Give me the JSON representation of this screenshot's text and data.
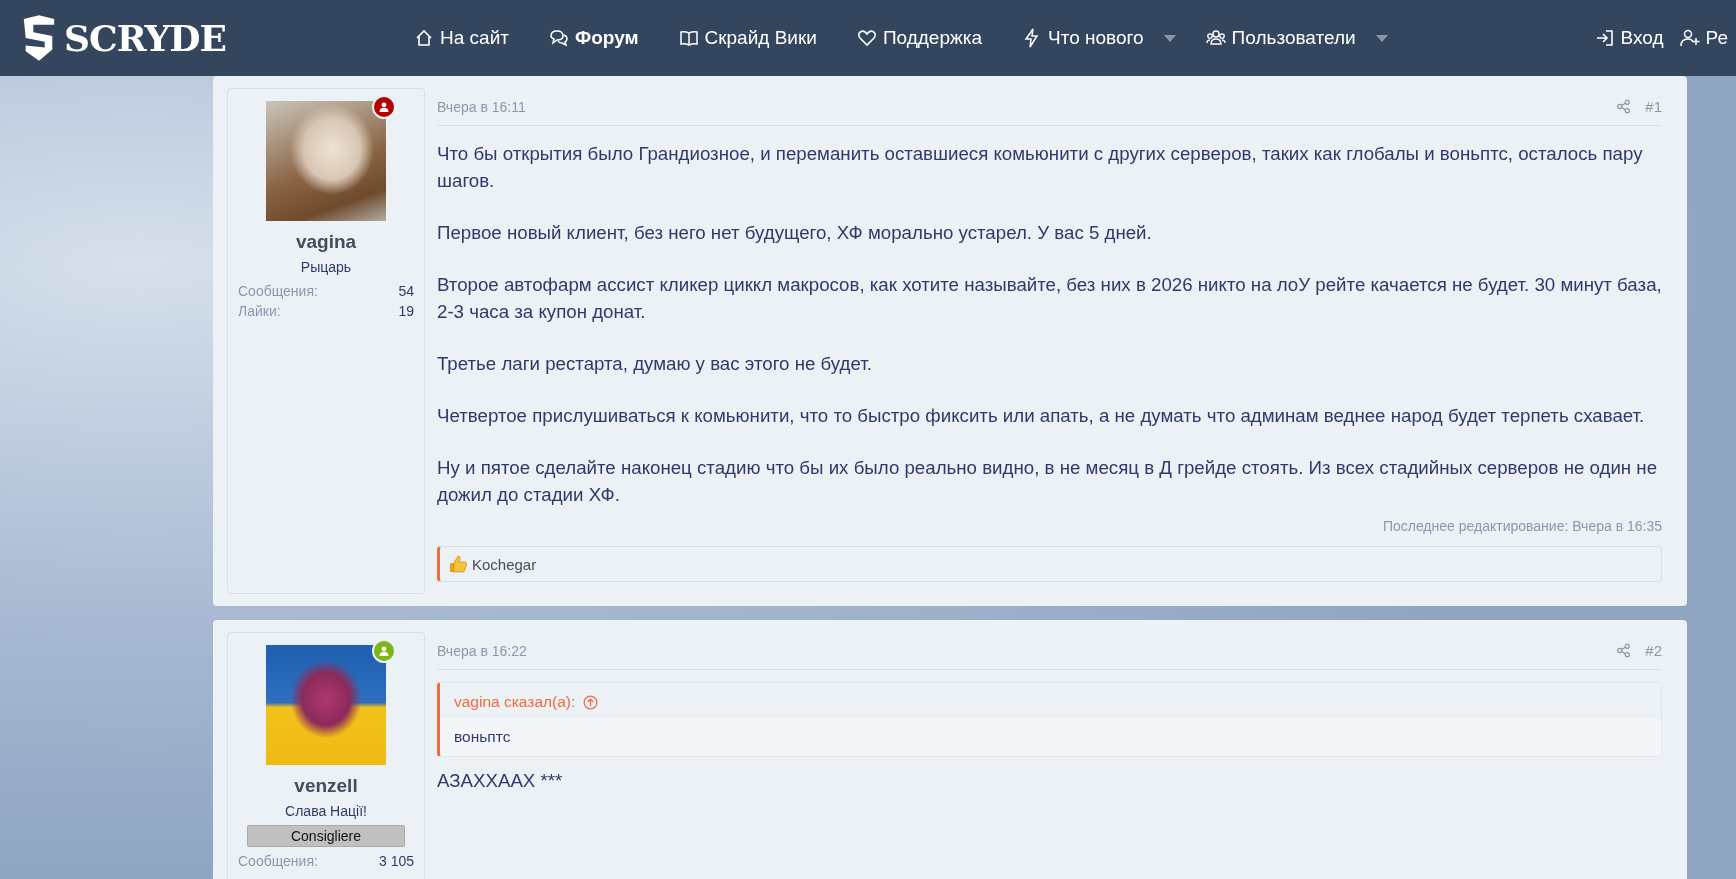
{
  "header": {
    "logo": "SCRYDE",
    "nav": [
      {
        "label": "На сайт",
        "selected": false,
        "dropdown": false
      },
      {
        "label": "Форум",
        "selected": true,
        "dropdown": false
      },
      {
        "label": "Скрайд Вики",
        "selected": false,
        "dropdown": false
      },
      {
        "label": "Поддержка",
        "selected": false,
        "dropdown": false
      },
      {
        "label": "Что нового",
        "selected": false,
        "dropdown": true
      },
      {
        "label": "Пользователи",
        "selected": false,
        "dropdown": true
      }
    ],
    "account": [
      {
        "label": "Вход"
      },
      {
        "label": "Ре"
      }
    ]
  },
  "posts": [
    {
      "user": {
        "name": "vagina",
        "title": "Рыцарь",
        "color": "#b40000",
        "stats": [
          {
            "label": "Сообщения:",
            "value": "54"
          },
          {
            "label": "Лайки:",
            "value": "19"
          }
        ]
      },
      "date": "Вчера в 16:11",
      "number": "#1",
      "paragraphs": [
        "Что бы открытия было Грандиозное, и переманить оставшиеся комьюнити с других серверов, таких как глобалы и воньптс, осталось пару шагов.",
        "Первое новый клиент, без него нет будущего, ХФ морально устарел. У вас 5 дней.",
        "Второе автофарм ассист кликер циккл макросов, как хотите называйте, без них в 2026 никто на лоУ рейте качается не будет. 30 минут база, 2-3 часа за купон донат.",
        "Третье лаги рестарта, думаю у вас этого не будет.",
        "Четвертое прислушиваться к комьюнити, что то быстро фиксить или апать, а не думать что админам веднее народ будет терпеть схавает.",
        "Ну и пятое сделайте наконец стадию что бы их было реально видно, в не месяц в Д грейде стоять. Из всех стадийных серверов не один не дожил до стадии ХФ."
      ],
      "edited": "Последнее редактирование: Вчера в 16:35",
      "reactions": "Kochegar"
    },
    {
      "user": {
        "name": "venzell",
        "title": "Слава Нації!",
        "color": "#7cb518",
        "banner": "Consigliere",
        "stats": [
          {
            "label": "Сообщения:",
            "value": "3 105"
          }
        ]
      },
      "date": "Вчера в 16:22",
      "number": "#2",
      "quote": {
        "author": "vagina сказал(а):",
        "text": "воньптс"
      },
      "paragraphs": [
        "АЗАХХААХ ***"
      ]
    }
  ]
}
